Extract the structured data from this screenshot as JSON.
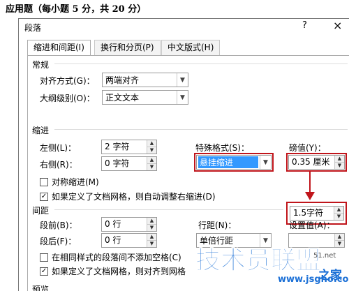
{
  "heading": "应用题（每小题 5 分，共 20 分）",
  "dialog": {
    "title": "段落",
    "help_glyph": "?",
    "close_glyph": "×",
    "tabs": [
      "缩进和间距(I)",
      "换行和分页(P)",
      "中文版式(H)"
    ]
  },
  "general": {
    "section": "常规",
    "align_label": "对齐方式(G)：",
    "align_value": "两端对齐",
    "outline_label": "大纲级别(O)：",
    "outline_value": "正文文本"
  },
  "indent": {
    "section": "缩进",
    "left_label": "左侧(L)：",
    "left_value": "2 字符",
    "right_label": "右侧(R)：",
    "right_value": "0 字符",
    "special_label": "特殊格式(S)：",
    "special_value": "悬挂缩进",
    "by_label": "磅值(Y)：",
    "by_value": "0.35 厘米",
    "by_value_new": "1.5字符",
    "mirror": "对称缩进(M)",
    "auto_adjust": "如果定义了文档网格，则自动调整右缩进(D)"
  },
  "spacing": {
    "section": "间距",
    "before_label": "段前(B)：",
    "before_value": "0 行",
    "after_label": "段后(F)：",
    "after_value": "0 行",
    "line_label": "行距(N)：",
    "line_value": "单倍行距",
    "at_label": "设置值(A)：",
    "at_value": "",
    "no_space": "在相同样式的段落间不添加空格(C)",
    "snap_grid": "如果定义了文档网格，则对齐到网格"
  },
  "preview": {
    "section": "预览"
  },
  "watermark": {
    "main": "技术员联盟",
    "url": "www.jsgho.com",
    "tag": "51.net",
    "cn": "之家"
  },
  "icons": {
    "dropdown": "chevron-down-icon",
    "spinner": "spinner-arrows-icon",
    "checkbox": "check-icon",
    "arrow": "red-arrow-icon"
  },
  "colors": {
    "highlight": "#c0151b",
    "selection": "#3399ff",
    "watermark": "#1a6fd6"
  }
}
